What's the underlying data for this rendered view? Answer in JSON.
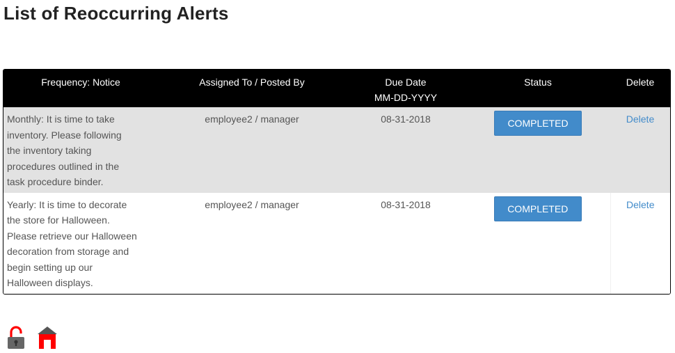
{
  "page": {
    "title": "List of Reoccurring Alerts"
  },
  "table": {
    "headers": {
      "notice": "Frequency: Notice",
      "assigned": "Assigned To / Posted By",
      "due_date": "Due Date",
      "due_date_format": "MM-DD-YYYY",
      "status": "Status",
      "delete": "Delete"
    },
    "rows": [
      {
        "notice": "Monthly: It is time to take inventory. Please following the inventory taking procedures outlined in the task procedure binder.",
        "assigned": "employee2 / manager",
        "due_date": "08-31-2018",
        "status": "COMPLETED",
        "delete": "Delete"
      },
      {
        "notice": "Yearly: It is time to decorate the store for Halloween. Please retrieve our Halloween decoration from storage and begin setting up our Halloween displays.",
        "assigned": "employee2 / manager",
        "due_date": "08-31-2018",
        "status": "COMPLETED",
        "delete": "Delete"
      }
    ]
  },
  "footer": {
    "icons": [
      "unlock-icon",
      "home-icon"
    ]
  },
  "colors": {
    "header_bg": "#000000",
    "status_button": "#428bca",
    "link": "#428bca",
    "row_alt": "#e2e2e2",
    "icon_red": "#ff0000",
    "icon_gray": "#666666"
  }
}
